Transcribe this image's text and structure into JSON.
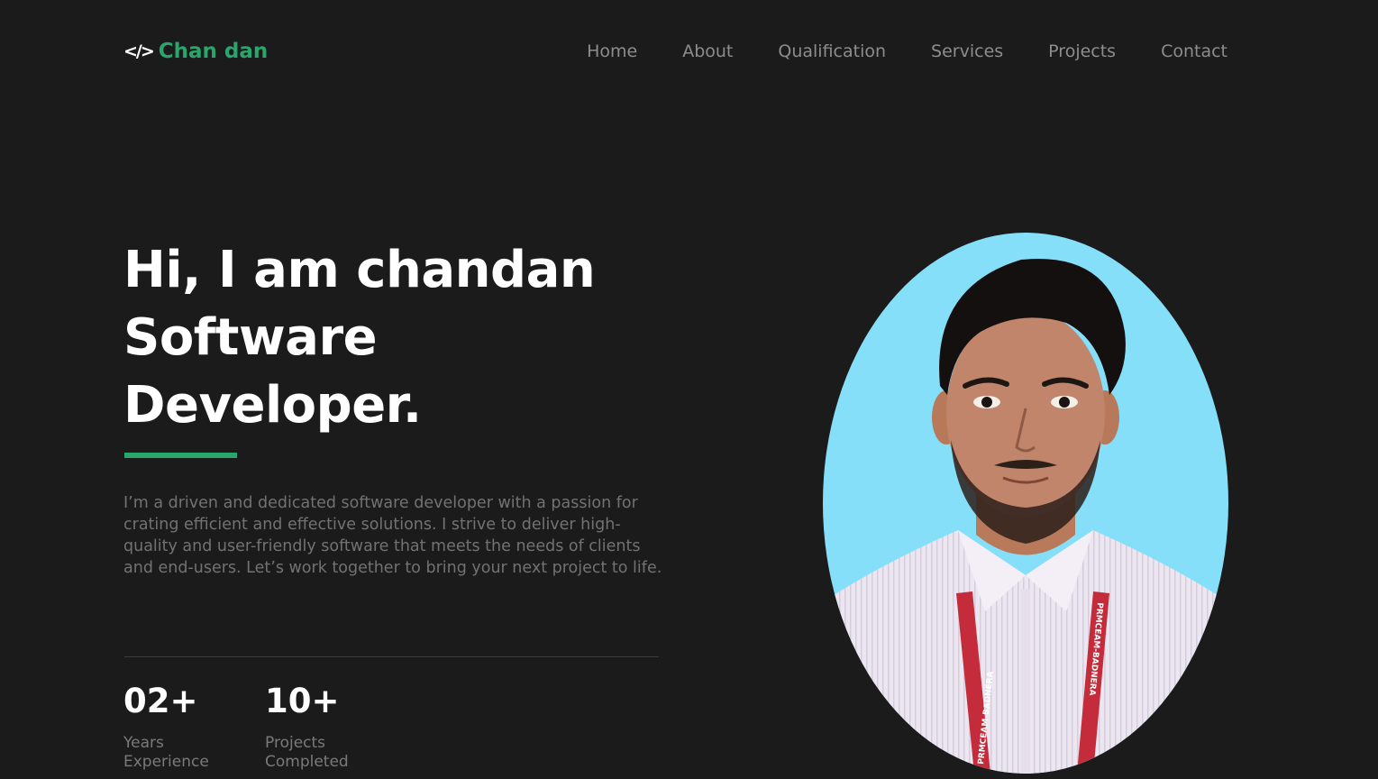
{
  "logo": {
    "text": "Chan dan",
    "icon": "code-icon",
    "icon_glyph": "</>"
  },
  "nav": {
    "items": [
      "Home",
      "About",
      "Qualification",
      "Services",
      "Projects",
      "Contact"
    ]
  },
  "hero": {
    "line1": "Hi, I am chandan",
    "line2": "Software",
    "line3": "Developer.",
    "intro": "I’m a driven and dedicated software developer with a passion for crating efficient and effective solutions. I strive to deliver high-quality and user-friendly software that meets the needs of clients and end-users. Let’s work together to bring your next project to life."
  },
  "stats": [
    {
      "value": "02+",
      "label_line1": "Years",
      "label_line2": "Experience"
    },
    {
      "value": "10+",
      "label_line1": "Projects",
      "label_line2": "Completed"
    }
  ],
  "portrait": {
    "lanyard_text": "PRMCEAM-BADNERA"
  },
  "colors": {
    "background": "#1b1b1b",
    "accent": "#2aa56b",
    "portrait_bg": "#86dff8"
  }
}
